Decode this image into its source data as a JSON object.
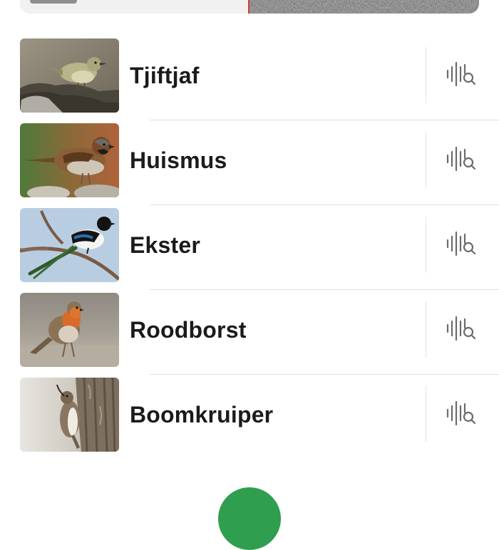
{
  "recording": {
    "cursor_color": "#d83b3b"
  },
  "species": [
    {
      "name": "Tjiftjaf",
      "icon": "analyze-sound-icon"
    },
    {
      "name": "Huismus",
      "icon": "analyze-sound-icon"
    },
    {
      "name": "Ekster",
      "icon": "analyze-sound-icon"
    },
    {
      "name": "Roodborst",
      "icon": "analyze-sound-icon"
    },
    {
      "name": "Boomkruiper",
      "icon": "analyze-sound-icon"
    }
  ],
  "colors": {
    "icon": "#6b6b6b",
    "fab": "#2f9e4e"
  }
}
